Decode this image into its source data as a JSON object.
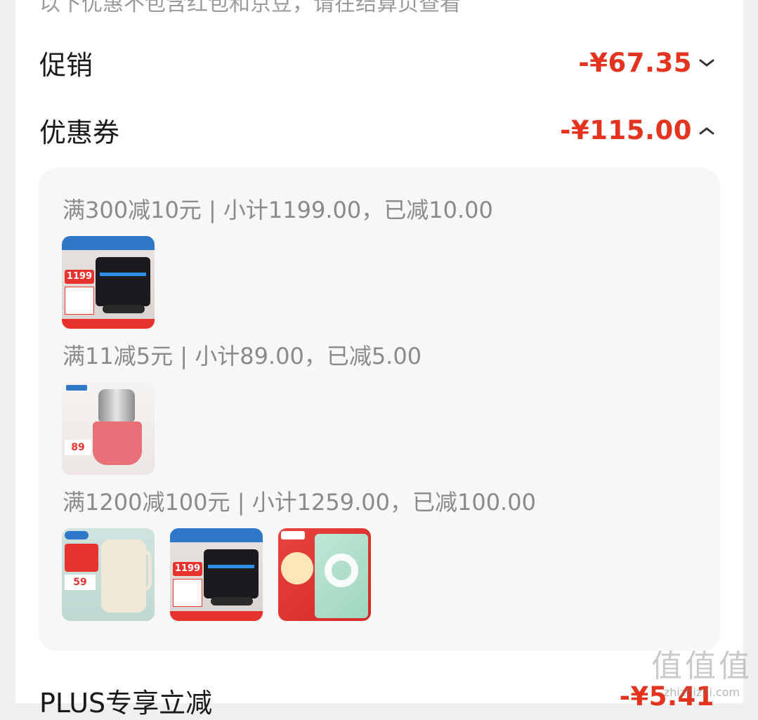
{
  "notice": "以下优惠不包含红包和京豆，请在结算页查看",
  "promotion": {
    "label": "促销",
    "amount": "-¥67.35"
  },
  "coupon": {
    "label": "优惠券",
    "amount": "-¥115.00"
  },
  "coupon_groups": [
    {
      "title": "满300减10元 | 小计1199.00，已减10.00",
      "items": [
        "range-hood-product"
      ]
    },
    {
      "title": "满11减5元 | 小计89.00，已减5.00",
      "items": [
        "meat-chopper-product"
      ]
    },
    {
      "title": "满1200减100元 | 小计1259.00，已减100.00",
      "items": [
        "kettle-product",
        "range-hood-product",
        "tape-product"
      ]
    }
  ],
  "thumb_text": {
    "hood_price": "1199",
    "chopper_price": "89",
    "kettle_price": "59"
  },
  "plus": {
    "label": "PLUS专享立减",
    "amount": "-¥5.41"
  },
  "watermark": {
    "big": "值值值",
    "small": "zhizhizhi.com"
  },
  "colors": {
    "accent": "#e4341f",
    "muted": "#8a8a8a",
    "panel": "#f7f7f7"
  }
}
